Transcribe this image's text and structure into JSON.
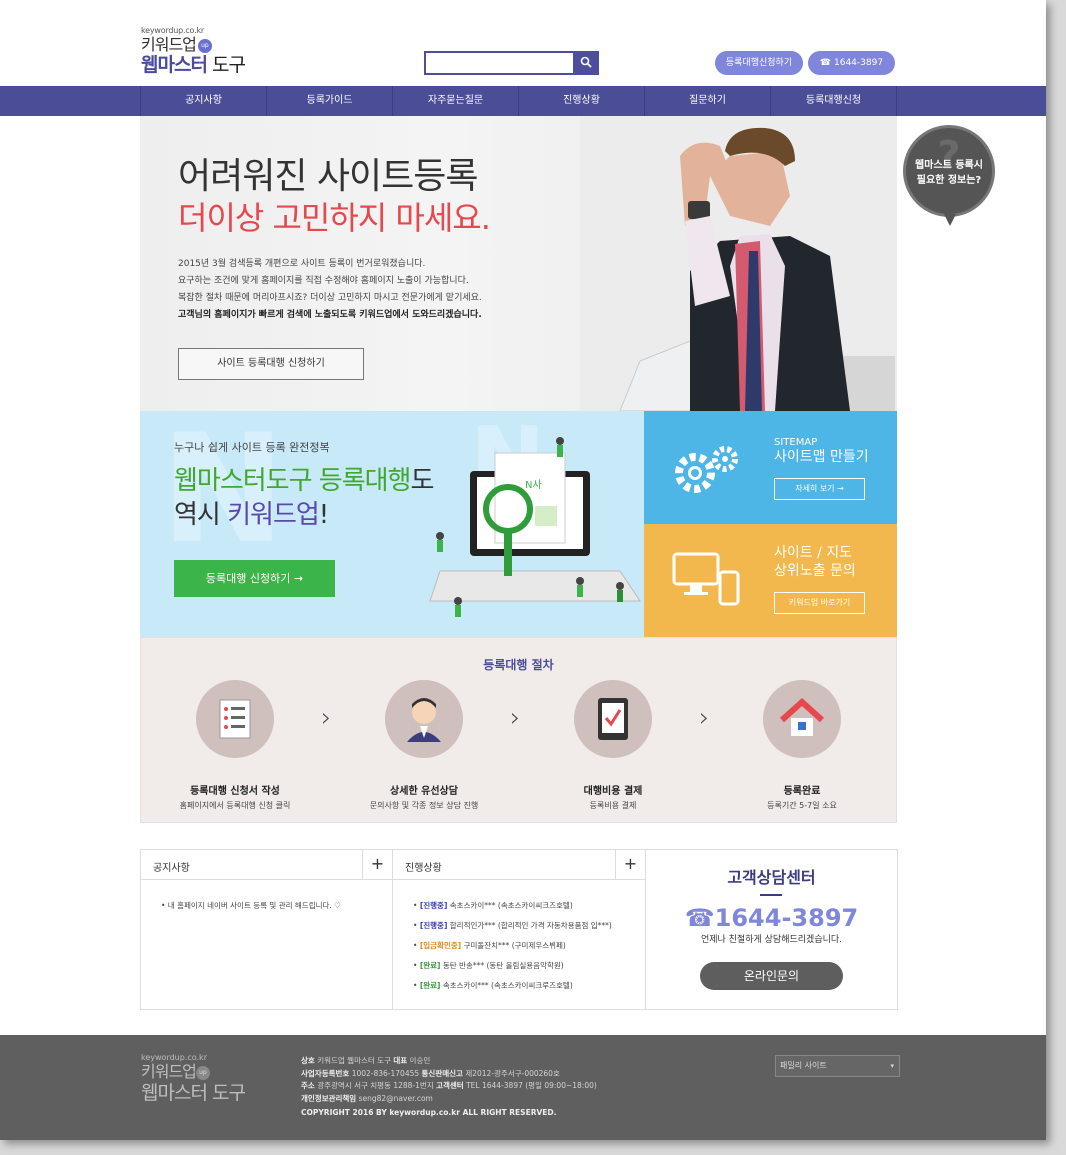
{
  "header": {
    "logo_small": "keywordup.co.kr",
    "logo_mid": "키워드업",
    "logo_up": "up",
    "logo_big_a": "웹마스터",
    "logo_big_b": " 도구",
    "search_placeholder": "",
    "apply_btn": "등록대행신청하기",
    "phone_btn": "☎ 1644-3897"
  },
  "nav": [
    "공지사항",
    "등록가이드",
    "자주묻는질문",
    "진행상황",
    "질문하기",
    "등록대행신청"
  ],
  "hero": {
    "title1": "어려워진 사이트등록",
    "title2": "더이상 고민하지 마세요.",
    "p1": "2015년 3월 검색등록 개편으로 사이트 등록이 번거로워졌습니다.",
    "p2": "요구하는 조건에 맞게 홈페이지를 직접 수정해야 홈페이지 노출이 가능합니다.",
    "p3": "복잡한 절차 때문에 머리아프시죠? 더이상 고민하지 마시고 전문가에게 맡기세요.",
    "p4": "고객님의 홈페이지가 빠르게 검색에 노출되도록 키워드업에서 도와드리겠습니다.",
    "button": "사이트 등록대행 신청하기"
  },
  "badge": {
    "q": "?",
    "line1": "웹마스트 등록시",
    "line2": "필요한 정보는?"
  },
  "promo": {
    "sub": "누구나 쉽게 사이트 등록 완전정복",
    "l1_green": "웹마스터도구 등록대행",
    "l1_rest": "도",
    "l2_a": "역시 ",
    "l2_purple": "키워드업",
    "l2_b": "!",
    "button": "등록대행 신청하기 →",
    "screen_text": "N사"
  },
  "sitemap": {
    "en": "SITEMAP",
    "ko": "사이트맵 만들기",
    "button": "자세히 보기  →"
  },
  "exposure": {
    "ko1": "사이트 / 지도",
    "ko2": "상위노출 문의",
    "button": "키워드업 바로가기"
  },
  "process": {
    "title": "등록대행 절차",
    "steps": [
      {
        "name": "등록대행 신청서 작성",
        "desc": "홈페이지에서 등록대행 신청 클릭"
      },
      {
        "name": "상세한 유선상담",
        "desc": "문의사항 및 각종 정보 상담 진행"
      },
      {
        "name": "대행비용 결제",
        "desc": "등록비용 결제"
      },
      {
        "name": "등록완료",
        "desc": "등록기간 5-7일 소요"
      }
    ],
    "arrow": "›"
  },
  "notice": {
    "title": "공지사항",
    "plus": "+",
    "items": [
      "• 내 홈페이지 네이버 사이트 등록 및 관리 해드립니다. ♡"
    ]
  },
  "progress": {
    "title": "진행상황",
    "plus": "+",
    "items": [
      {
        "tag": "[진행중]",
        "text": "속초스카이*** (속초스카이씨크즈호텔)"
      },
      {
        "tag": "[진행중]",
        "text": "합리적인가*** (합리적인 가격 자동차용품점 입***)"
      },
      {
        "tag": "[입금확인중]",
        "text": "구미돌잔치*** (구미제우스뷔페)"
      },
      {
        "tag": "[완료]",
        "text": "동탄 반송*** (동탄 올림실용음악학원)"
      },
      {
        "tag": "[완료]",
        "text": "속초스카이*** (속초스카이씨크루즈호텔)"
      }
    ],
    "colors": {
      "진행중": "#3b3db0",
      "입금확인중": "#e08a1e",
      "완료": "#3a9a3a"
    }
  },
  "cs": {
    "title": "고객상담센터",
    "phone": "☎1644-3897",
    "desc": "언제나 친절하게 상담해드리겠습니다.",
    "button": "온라인문의"
  },
  "footer": {
    "logo_small": "keywordup.co.kr",
    "logo_mid": "키워드업",
    "logo_up": "up",
    "logo_big": "웹마스터 도구",
    "l1_a": "상호",
    "l1_b": " 키워드업 웹마스터 도구  ",
    "l1_c": "대표",
    "l1_d": " 이승민",
    "l2_a": "사업자등록번호",
    "l2_b": " 1002-836-170455  ",
    "l2_c": "통신판매신고",
    "l2_d": " 제2012-광주서구-000260호",
    "l3_a": "주소",
    "l3_b": " 광주광역시 서구 치평동 1288-1번지  ",
    "l3_c": "고객센터",
    "l3_d": " TEL 1644-3897 (평일 09:00~18:00)",
    "l4_a": "개인정보관리책임",
    "l4_b": " seng82@naver.com",
    "copyright": "COPYRIGHT 2016 BY keywordup.co.kr ALL RIGHT RESERVED.",
    "family_site": "패밀리 사이트",
    "caret": "▾"
  }
}
